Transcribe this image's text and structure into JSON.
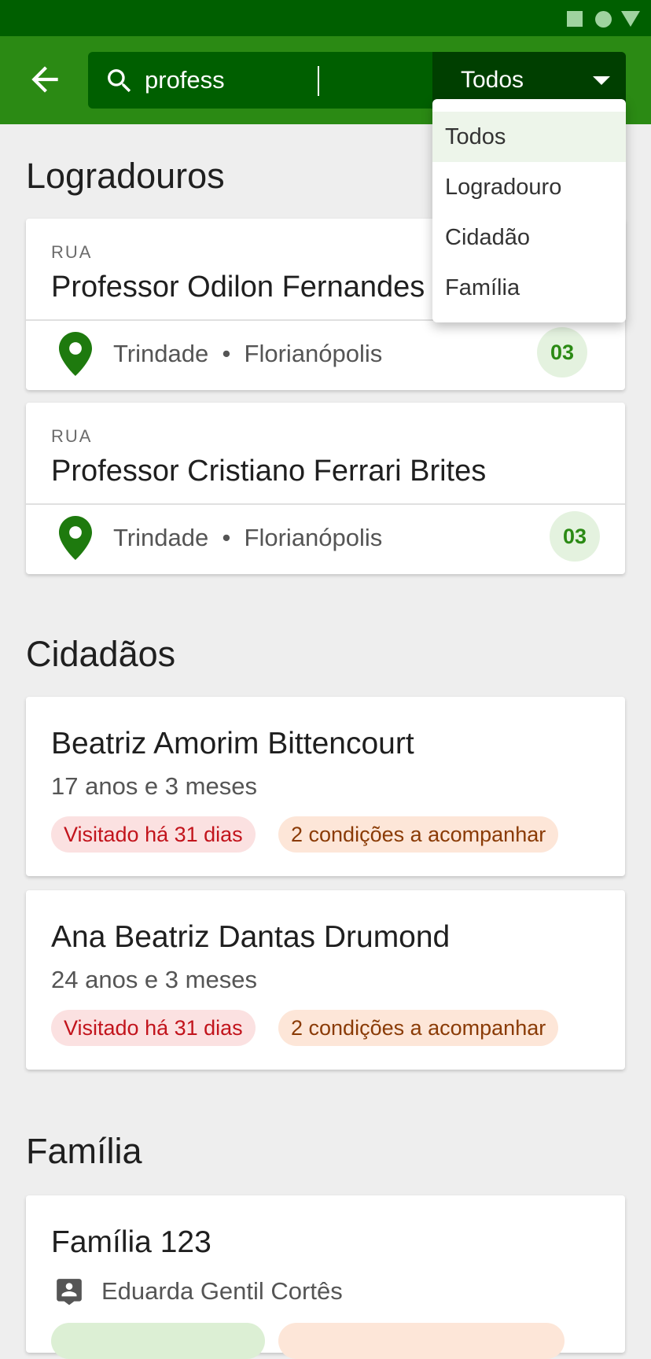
{
  "search": {
    "query": "profess",
    "filter_value": "Todos",
    "filter_options": [
      "Todos",
      "Logradouro",
      "Cidadão",
      "Família"
    ]
  },
  "logradouros": {
    "title": "Logradouros",
    "items": [
      {
        "type": "RUA",
        "name": "Professor Odilon Fernandes",
        "neighborhood": "Trindade",
        "city": "Florianópolis",
        "count": "03"
      },
      {
        "type": "RUA",
        "name": "Professor Cristiano Ferrari Brites",
        "neighborhood": "Trindade",
        "city": "Florianópolis",
        "count": "03"
      }
    ]
  },
  "cidadaos": {
    "title": "Cidadãos",
    "items": [
      {
        "name": "Beatriz Amorim Bittencourt",
        "age": "17 anos e 3 meses",
        "visit": "Visitado há 31 dias",
        "conditions": "2 condições a acompanhar"
      },
      {
        "name": "Ana Beatriz Dantas Drumond",
        "age": "24 anos e 3 meses",
        "visit": "Visitado há 31 dias",
        "conditions": "2 condições a acompanhar"
      }
    ]
  },
  "familia": {
    "title": "Família",
    "items": [
      {
        "name": "Família 123",
        "responsible": "Eduarda Gentil Cortês"
      }
    ]
  },
  "colors": {
    "status_bar": "#005f00",
    "app_bar": "#2b8a14",
    "search_box": "#005f00",
    "accent_green": "#2b8a14",
    "alert_red": "#c2141c",
    "warning_brown": "#8a3b06"
  },
  "icons": [
    "back-arrow-icon",
    "search-icon",
    "chevron-down-icon",
    "location-pin-icon",
    "person-badge-icon"
  ]
}
